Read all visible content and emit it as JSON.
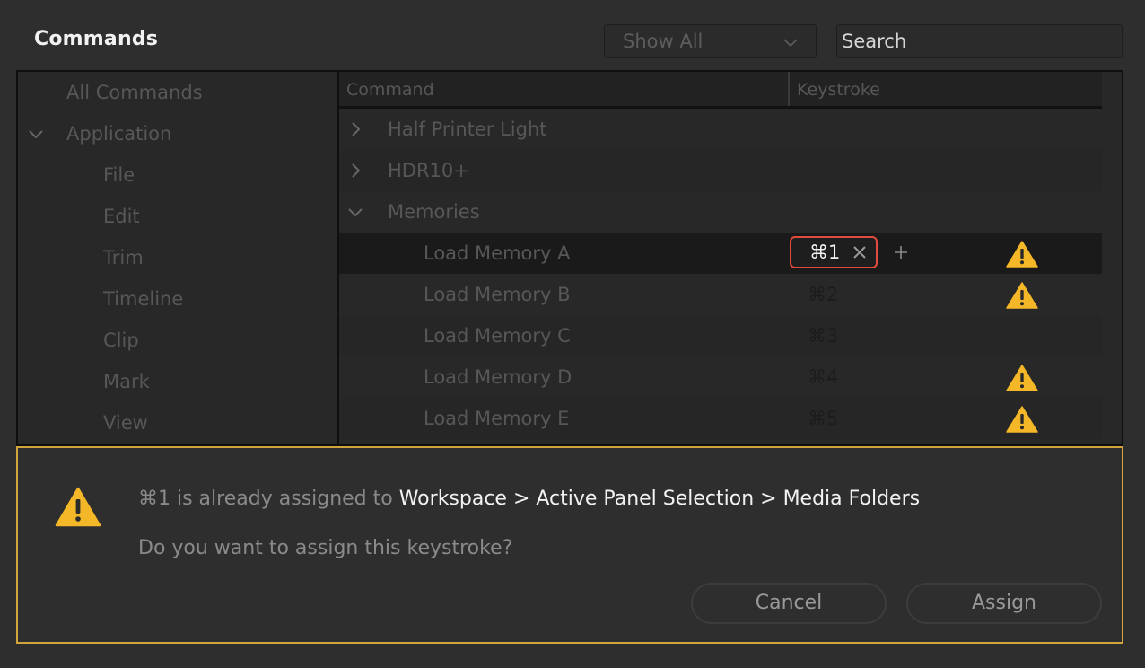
{
  "header": {
    "title": "Commands",
    "filter_dropdown": {
      "selected": "Show All"
    },
    "search": {
      "placeholder": "Search",
      "value": ""
    }
  },
  "sidebar": {
    "items": [
      {
        "label": "All Commands",
        "level": 0,
        "expanded": null
      },
      {
        "label": "Application",
        "level": 0,
        "expanded": true
      },
      {
        "label": "File",
        "level": 1
      },
      {
        "label": "Edit",
        "level": 1
      },
      {
        "label": "Trim",
        "level": 1
      },
      {
        "label": "Timeline",
        "level": 1
      },
      {
        "label": "Clip",
        "level": 1
      },
      {
        "label": "Mark",
        "level": 1
      },
      {
        "label": "View",
        "level": 1
      }
    ]
  },
  "table": {
    "columns": [
      "Command",
      "Keystroke"
    ],
    "rows": [
      {
        "label": "Half Printer Light",
        "group": true,
        "expanded": false,
        "keystroke": "",
        "warning": false
      },
      {
        "label": "HDR10+",
        "group": true,
        "expanded": false,
        "keystroke": "",
        "warning": false
      },
      {
        "label": "Memories",
        "group": true,
        "expanded": true,
        "keystroke": "",
        "warning": false
      },
      {
        "label": "Load Memory A",
        "group": false,
        "keystroke": "⌘1",
        "editing": true,
        "selected": true,
        "warning": true
      },
      {
        "label": "Load Memory B",
        "group": false,
        "keystroke": "⌘2",
        "warning": true
      },
      {
        "label": "Load Memory C",
        "group": false,
        "keystroke": "⌘3",
        "warning": false
      },
      {
        "label": "Load Memory D",
        "group": false,
        "keystroke": "⌘4",
        "warning": true
      },
      {
        "label": "Load Memory E",
        "group": false,
        "keystroke": "⌘5",
        "warning": true
      }
    ]
  },
  "conflict_dialog": {
    "message_prefix": "⌘1 is already assigned to ",
    "message_target": "Workspace > Active Panel Selection > Media Folders",
    "question": "Do you want to assign this keystroke?",
    "cancel_label": "Cancel",
    "assign_label": "Assign"
  },
  "colors": {
    "warning": "#f4b728",
    "dialog_border": "#d3a33e",
    "key_edit_border": "#e24a3d"
  }
}
